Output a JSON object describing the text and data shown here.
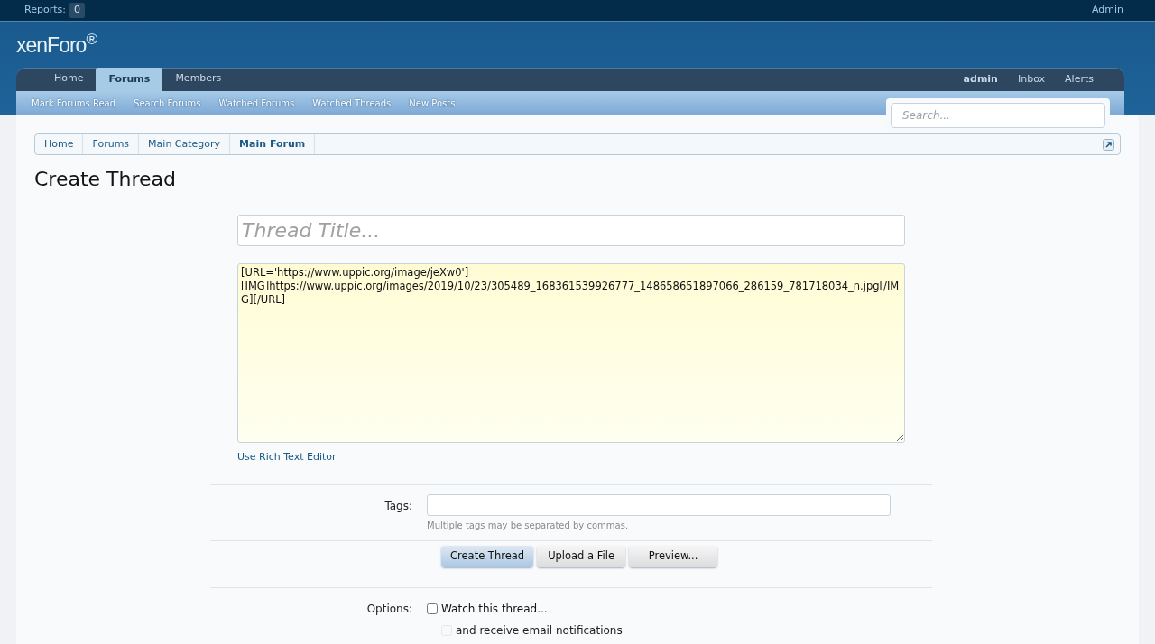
{
  "top_bar": {
    "reports_label": "Reports:",
    "reports_count": "0",
    "user": "Admin"
  },
  "logo": "xenForo$^{®}$",
  "nav_tabs": [
    {
      "label": "Home",
      "selected": false
    },
    {
      "label": "Forums",
      "selected": true
    },
    {
      "label": "Members",
      "selected": false
    }
  ],
  "user_links": [
    "admin",
    "Inbox",
    "Alerts"
  ],
  "sub_nav": [
    "Mark Forums Read",
    "Search Forums",
    "Watched Forums",
    "Watched Threads",
    "New Posts"
  ],
  "search": {
    "placeholder": "Search..."
  },
  "breadcrumb": [
    {
      "label": "Home",
      "current": false
    },
    {
      "label": "Forums",
      "current": false
    },
    {
      "label": "Main Category",
      "current": false
    },
    {
      "label": "Main Forum",
      "current": true
    }
  ],
  "page_title": "Create Thread",
  "form": {
    "title_placeholder": "Thread Title...",
    "message": "[URL='https://www.uppic.org/image/jeXw0']\n[IMG]https://www.uppic.org/images/2019/10/23/305489_168361539926777_148658651897066_286159_781718034_n.jpg[/IMG][/URL]",
    "rich_editor_link": "Use Rich Text Editor",
    "tags_label": "Tags:",
    "tags_hint": "Multiple tags may be separated by commas.",
    "buttons": [
      {
        "label": "Create Thread",
        "kind": "primary"
      },
      {
        "label": "Upload a File",
        "kind": "secondary"
      },
      {
        "label": "Preview...",
        "kind": "secondary"
      }
    ],
    "options_label": "Options:",
    "options": [
      {
        "label": "Watch this thread...",
        "checked": false,
        "disabled": false
      },
      {
        "label": "and receive email notifications",
        "checked": false,
        "disabled": true
      }
    ]
  }
}
